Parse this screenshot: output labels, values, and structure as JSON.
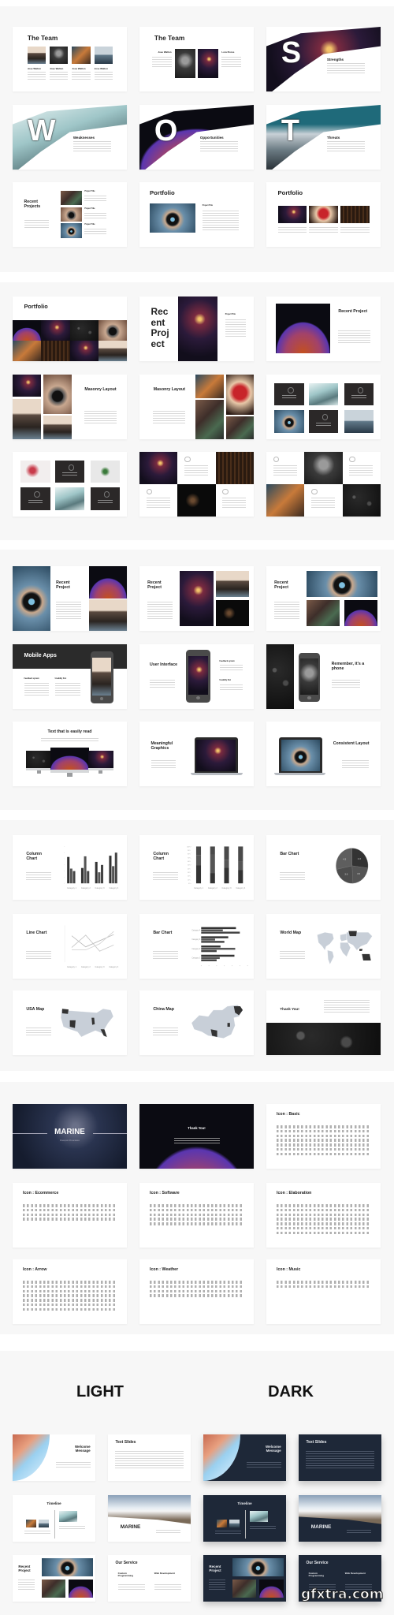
{
  "colors": {
    "section_bg": "#f7f7f7",
    "dark_slide": "#1e2838",
    "chart_dark": "#333333",
    "map_land": "#c8cfd8"
  },
  "sections": [
    {
      "slides": [
        {
          "layout": "team4",
          "title": "The Team",
          "names": [
            "Jose Walton",
            "Jose Walton",
            "Jose Walton",
            "Jose Walton"
          ],
          "photos": [
            "coast",
            "portrait",
            "forest",
            "sea"
          ]
        },
        {
          "layout": "team2",
          "title": "The Team",
          "names": [
            "Jose Walton",
            "Lora Flores"
          ],
          "photos": [
            "portrait",
            "night"
          ]
        },
        {
          "layout": "swot",
          "letter": "S",
          "title": "Strengths",
          "photo": "night"
        },
        {
          "layout": "swot",
          "letter": "W",
          "title": "Weaknesses",
          "photo": "ice"
        },
        {
          "layout": "swot",
          "letter": "O",
          "title": "Opportunities",
          "photo": "dome"
        },
        {
          "layout": "swot",
          "letter": "T",
          "title": "Threats",
          "photo": "teal"
        },
        {
          "layout": "recentProjects",
          "title": "Recent Projects",
          "items": [
            "Project Title",
            "Project Title",
            "Project Title"
          ],
          "photos": [
            "street",
            "camera",
            "lens"
          ]
        },
        {
          "layout": "portfolio1",
          "title": "Portfolio",
          "item": "Project Title",
          "photo": "lens"
        },
        {
          "layout": "portfolio3",
          "title": "Portfolio",
          "photos": [
            "night",
            "heart",
            "wood"
          ]
        }
      ]
    },
    {
      "slides": [
        {
          "layout": "portfolioGrid",
          "title": "Portfolio",
          "photos": [
            "dome",
            "night",
            "leaves",
            "camera",
            "forest",
            "wood",
            "night",
            "coast"
          ]
        },
        {
          "layout": "recentBig",
          "title_lines": [
            "Rec",
            "ent",
            "Proj",
            "ect"
          ],
          "item": "Project Title",
          "photo": "night"
        },
        {
          "layout": "recentDome",
          "title": "Recent Project",
          "photo": "dome"
        },
        {
          "layout": "masonryL",
          "title": "Masonry Layout",
          "photos": [
            "night",
            "coast",
            "camera",
            "coast"
          ]
        },
        {
          "layout": "masonryR",
          "title": "Masonry Layout",
          "photos": [
            "forest",
            "street",
            "heart",
            "street"
          ]
        },
        {
          "layout": "tiles6",
          "tiles": [
            "dark",
            "ice",
            "dark",
            "lens",
            "dark",
            "sea"
          ]
        },
        {
          "layout": "tiles6",
          "tiles": [
            "flowers",
            "dark",
            "plant",
            "dark",
            "ice",
            "dark"
          ]
        },
        {
          "layout": "checker",
          "cells": [
            "night",
            "text",
            "wood",
            "text",
            "black",
            "text"
          ]
        },
        {
          "layout": "checker",
          "cells": [
            "text",
            "portrait",
            "text",
            "forest",
            "text",
            "leaves"
          ]
        }
      ]
    },
    {
      "slides": [
        {
          "layout": "recentLens",
          "title": "Recent Project",
          "photos": [
            "lens",
            "dome",
            "coast"
          ]
        },
        {
          "layout": "recentB",
          "title": "Recent Project",
          "photos": [
            "night",
            "coast",
            "black"
          ]
        },
        {
          "layout": "recentC",
          "title": "Recent Project",
          "photos": [
            "lens",
            "street",
            "dome"
          ]
        },
        {
          "layout": "mobileApps",
          "title": "Mobile Apps",
          "features": [
            "Feedback system",
            "Usability first"
          ],
          "photo": "coast"
        },
        {
          "layout": "userInterface",
          "title": "User Interface",
          "features": [
            "Feedback system",
            "Usability first"
          ],
          "photo": "night"
        },
        {
          "layout": "phone",
          "title": "Remember, it's a phone",
          "photos": [
            "leaves",
            "portrait"
          ]
        },
        {
          "layout": "textMonitors",
          "title": "Text that is easily read",
          "photos": [
            "leaves",
            "dome",
            "night"
          ]
        },
        {
          "layout": "laptopLeft",
          "title": "Meaningful Graphics",
          "photo": "night"
        },
        {
          "layout": "laptopRight",
          "title": "Consistent Layout",
          "photo": "lens"
        }
      ]
    },
    {
      "slides": [
        {
          "layout": "chart",
          "title": "Column Chart",
          "chart": 0
        },
        {
          "layout": "chart",
          "title": "Column Chart",
          "chart": 1
        },
        {
          "layout": "chart",
          "title": "Bar Chart",
          "chart": 2
        },
        {
          "layout": "chart",
          "title": "Line Chart",
          "chart": 3
        },
        {
          "layout": "chart",
          "title": "Bar Chart",
          "chart": 4
        },
        {
          "layout": "map",
          "title": "World Map",
          "map": "world"
        },
        {
          "layout": "map",
          "title": "USA Map",
          "map": "usa"
        },
        {
          "layout": "map",
          "title": "China Map",
          "map": "china"
        },
        {
          "layout": "thanksLeaves",
          "title": "Thank You!",
          "photo": "leaves"
        }
      ]
    },
    {
      "slides": [
        {
          "layout": "cover",
          "title": "MARINE",
          "subtitle": "Powerpoint Presentation"
        },
        {
          "layout": "thanksDome",
          "title": "Thank You!"
        },
        {
          "layout": "icons",
          "title": "Icon : Basic",
          "icon_rows": 7
        },
        {
          "layout": "icons",
          "title": "Icon : Ecommerce",
          "icon_rows": 4
        },
        {
          "layout": "icons",
          "title": "Icon : Software",
          "icon_rows": 5
        },
        {
          "layout": "icons",
          "title": "Icon : Elaboration",
          "icon_rows": 7
        },
        {
          "layout": "icons",
          "title": "Icon : Arrow",
          "icon_rows": 7
        },
        {
          "layout": "icons",
          "title": "Icon : Weather",
          "icon_rows": 4
        },
        {
          "layout": "icons",
          "title": "Icon : Music",
          "icon_rows": 2
        }
      ]
    }
  ],
  "variants": {
    "light": {
      "label": "LIGHT",
      "slides": [
        {
          "layout": "welcome",
          "title": "Welcome Message"
        },
        {
          "layout": "textSlides",
          "title": "Text Slides"
        },
        {
          "layout": "timeline",
          "title": "Timeline"
        },
        {
          "layout": "marine",
          "title": "MARINE"
        },
        {
          "layout": "recentSm",
          "title": "Recent Project"
        },
        {
          "layout": "service",
          "title": "Our Service",
          "services": [
            "Custom Programming",
            "Web Development"
          ]
        }
      ]
    },
    "dark": {
      "label": "DARK",
      "slides": [
        {
          "layout": "welcome",
          "title": "Welcome Message"
        },
        {
          "layout": "textSlides",
          "title": "Text Slides"
        },
        {
          "layout": "timeline",
          "title": "Timeline"
        },
        {
          "layout": "marine",
          "title": "MARINE"
        },
        {
          "layout": "recentSm",
          "title": "Recent Project"
        },
        {
          "layout": "service",
          "title": "Our Service",
          "services": [
            "Custom Programming",
            "Web Development"
          ]
        }
      ]
    }
  },
  "watermark": "gfxtra.com",
  "chart_data": [
    {
      "type": "bar",
      "orientation": "vertical",
      "mode": "grouped",
      "categories": [
        "Category 1",
        "Category 2",
        "Category 3",
        "Category 4"
      ],
      "series": [
        {
          "values": [
            4.3,
            2.5,
            3.5,
            4.5
          ]
        },
        {
          "values": [
            2.4,
            4.4,
            1.8,
            2.8
          ]
        },
        {
          "values": [
            2,
            2,
            3,
            5
          ]
        }
      ],
      "ylim": [
        0,
        6
      ],
      "colors": [
        "#333333",
        "#555555",
        "#444444"
      ]
    },
    {
      "type": "bar",
      "orientation": "vertical",
      "mode": "stacked-100",
      "categories": [
        "Category 1",
        "Category 2",
        "Category 3",
        "Category 4"
      ],
      "series": [
        {
          "values": [
            4.3,
            2.5,
            3.5,
            4.5
          ]
        },
        {
          "values": [
            2.4,
            4.4,
            1.8,
            2.8
          ]
        },
        {
          "values": [
            2,
            2,
            3,
            5
          ]
        }
      ],
      "ylim": [
        0,
        100
      ],
      "yticks": [
        "0%",
        "10%",
        "20%",
        "30%",
        "40%",
        "50%",
        "60%",
        "70%",
        "80%",
        "90%",
        "100%"
      ],
      "colors": [
        "#333333",
        "#555555",
        "#4a4a4a"
      ]
    },
    {
      "type": "pie",
      "values": [
        4.3,
        3.5,
        3.6,
        4.5
      ],
      "labels": [
        "4.3",
        "3.5",
        "3.6",
        "4.5"
      ],
      "colors": [
        "#333333",
        "#555555",
        "#4d4d4d",
        "#5e5e5e"
      ]
    },
    {
      "type": "line",
      "categories": [
        "Category 1",
        "Category 2",
        "Category 3",
        "Category 4"
      ],
      "series": [
        {
          "values": [
            4.3,
            2.5,
            3.5,
            4.5
          ]
        },
        {
          "values": [
            2.4,
            4.4,
            1.8,
            2.8
          ]
        },
        {
          "values": [
            2,
            2,
            3,
            5
          ]
        }
      ],
      "ylim": [
        0,
        6
      ],
      "colors": [
        "#bbbbbb",
        "#c8c8c8",
        "#d4d4d4"
      ]
    },
    {
      "type": "bar",
      "orientation": "horizontal",
      "mode": "grouped",
      "categories": [
        "Category 1",
        "Category 2",
        "Category 3",
        "Category 4"
      ],
      "series": [
        {
          "values": [
            4.3,
            2.5,
            3.5,
            4.5
          ]
        },
        {
          "values": [
            2.4,
            4.4,
            1.8,
            2.8
          ]
        },
        {
          "values": [
            2,
            2,
            3,
            5
          ]
        }
      ],
      "xlim": [
        0,
        6
      ],
      "colors": [
        "#333333",
        "#555555",
        "#444444"
      ]
    }
  ]
}
